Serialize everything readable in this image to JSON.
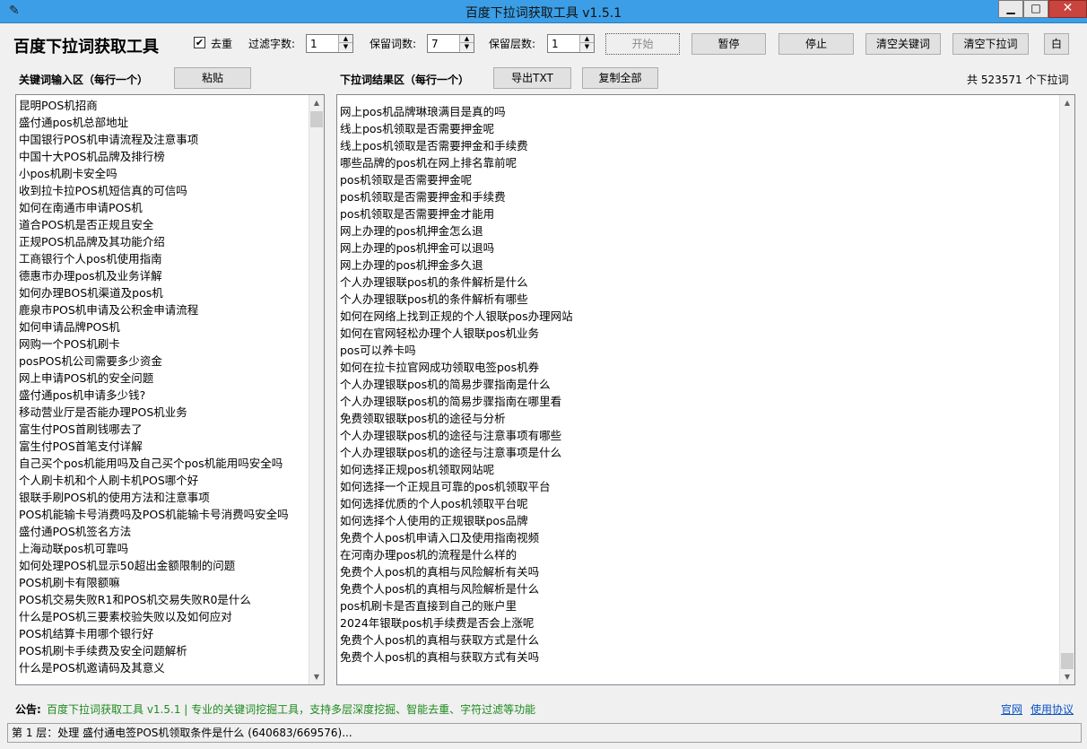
{
  "window": {
    "title": "百度下拉词获取工具 v1.5.1",
    "min": "▁",
    "max": "□",
    "close": "✕",
    "app_icon": "feather-icon"
  },
  "toolbar": {
    "app_title": "百度下拉词获取工具",
    "dedupe_label": "去重",
    "dedupe_checked": true,
    "filter_chars_label": "过滤字数:",
    "filter_chars_value": "1",
    "keep_words_label": "保留词数:",
    "keep_words_value": "7",
    "keep_levels_label": "保留层数:",
    "keep_levels_value": "1",
    "start": "开始",
    "pause": "暂停",
    "stop": "停止",
    "clear_keywords": "清空关键词",
    "clear_dropdown": "清空下拉词",
    "white": "白"
  },
  "keywords": {
    "label": "关键词输入区（每行一个）",
    "paste": "粘贴",
    "items": [
      "昆明POS机招商",
      "盛付通pos机总部地址",
      "中国银行POS机申请流程及注意事项",
      "中国十大POS机品牌及排行榜",
      "小pos机刷卡安全吗",
      "收到拉卡拉POS机短信真的可信吗",
      "如何在南通市申请POS机",
      "道合POS机是否正规且安全",
      "正规POS机品牌及其功能介绍",
      "工商银行个人pos机使用指南",
      "德惠市办理pos机及业务详解",
      "如何办理BOS机渠道及pos机",
      "鹿泉市POS机申请及公积金申请流程",
      "如何申请品牌POS机",
      "网购一个POS机刷卡",
      "posPOS机公司需要多少资金",
      "网上申请POS机的安全问题",
      "盛付通pos机申请多少钱?",
      "移动营业厅是否能办理POS机业务",
      "富生付POS首刷钱哪去了",
      "富生付POS首笔支付详解",
      "自己买个pos机能用吗及自己买个pos机能用吗安全吗",
      "个人刷卡机和个人刷卡机POS哪个好",
      "银联手刷POS机的使用方法和注意事项",
      "POS机能输卡号消费吗及POS机能输卡号消费吗安全吗",
      "盛付通POS机签名方法",
      "上海动联pos机可靠吗",
      "如何处理POS机显示50超出金额限制的问题",
      "POS机刷卡有限额嘛",
      "POS机交易失败R1和POS机交易失败R0是什么",
      "什么是POS机三要素校验失败以及如何应对",
      "POS机结算卡用哪个银行好",
      "POS机刷卡手续费及安全问题解析",
      "什么是POS机邀请码及其意义"
    ]
  },
  "results": {
    "label": "下拉词结果区（每行一个）",
    "export": "导出TXT",
    "copy_all": "复制全部",
    "count": "共 523571 个下拉词",
    "items": [
      "网上pos机品牌琳琅满目是真的吗",
      "线上pos机领取是否需要押金呢",
      "线上pos机领取是否需要押金和手续费",
      "哪些品牌的pos机在网上排名靠前呢",
      "pos机领取是否需要押金呢",
      "pos机领取是否需要押金和手续费",
      "pos机领取是否需要押金才能用",
      "网上办理的pos机押金怎么退",
      "网上办理的pos机押金可以退吗",
      "网上办理的pos机押金多久退",
      "个人办理银联pos机的条件解析是什么",
      "个人办理银联pos机的条件解析有哪些",
      "如何在网络上找到正规的个人银联pos办理网站",
      "如何在官网轻松办理个人银联pos机业务",
      "pos可以养卡吗",
      "如何在拉卡拉官网成功领取电签pos机券",
      "个人办理银联pos机的简易步骤指南是什么",
      "个人办理银联pos机的简易步骤指南在哪里看",
      "免费领取银联pos机的途径与分析",
      "个人办理银联pos机的途径与注意事项有哪些",
      "个人办理银联pos机的途径与注意事项是什么",
      "如何选择正规pos机领取网站呢",
      "如何选择一个正规且可靠的pos机领取平台",
      "如何选择优质的个人pos机领取平台呢",
      "如何选择个人使用的正规银联pos品牌",
      "免费个人pos机申请入口及使用指南视频",
      "在河南办理pos机的流程是什么样的",
      "免费个人pos机的真相与风险解析有关吗",
      "免费个人pos机的真相与风险解析是什么",
      "pos机刷卡是否直接到自己的账户里",
      "2024年银联pos机手续费是否会上涨呢",
      "免费个人pos机的真相与获取方式是什么",
      "免费个人pos机的真相与获取方式有关吗"
    ]
  },
  "notice": {
    "label": "公告:",
    "text": "百度下拉词获取工具 v1.5.1 | 专业的关键词挖掘工具，支持多层深度挖掘、智能去重、字符过滤等功能",
    "link_site": "官网",
    "link_terms": "使用协议"
  },
  "status": {
    "text": "第 1 层：处理 盛付通电签POS机领取条件是什么 (640683/669576)..."
  }
}
